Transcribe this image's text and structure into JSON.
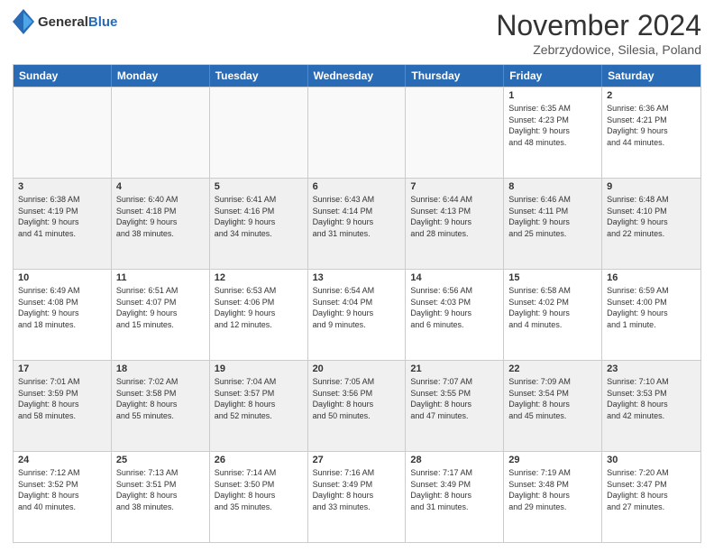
{
  "header": {
    "logo_general": "General",
    "logo_blue": "Blue",
    "month_title": "November 2024",
    "location": "Zebrzydowice, Silesia, Poland"
  },
  "weekdays": [
    "Sunday",
    "Monday",
    "Tuesday",
    "Wednesday",
    "Thursday",
    "Friday",
    "Saturday"
  ],
  "rows": [
    [
      {
        "day": "",
        "info": ""
      },
      {
        "day": "",
        "info": ""
      },
      {
        "day": "",
        "info": ""
      },
      {
        "day": "",
        "info": ""
      },
      {
        "day": "",
        "info": ""
      },
      {
        "day": "1",
        "info": "Sunrise: 6:35 AM\nSunset: 4:23 PM\nDaylight: 9 hours\nand 48 minutes."
      },
      {
        "day": "2",
        "info": "Sunrise: 6:36 AM\nSunset: 4:21 PM\nDaylight: 9 hours\nand 44 minutes."
      }
    ],
    [
      {
        "day": "3",
        "info": "Sunrise: 6:38 AM\nSunset: 4:19 PM\nDaylight: 9 hours\nand 41 minutes."
      },
      {
        "day": "4",
        "info": "Sunrise: 6:40 AM\nSunset: 4:18 PM\nDaylight: 9 hours\nand 38 minutes."
      },
      {
        "day": "5",
        "info": "Sunrise: 6:41 AM\nSunset: 4:16 PM\nDaylight: 9 hours\nand 34 minutes."
      },
      {
        "day": "6",
        "info": "Sunrise: 6:43 AM\nSunset: 4:14 PM\nDaylight: 9 hours\nand 31 minutes."
      },
      {
        "day": "7",
        "info": "Sunrise: 6:44 AM\nSunset: 4:13 PM\nDaylight: 9 hours\nand 28 minutes."
      },
      {
        "day": "8",
        "info": "Sunrise: 6:46 AM\nSunset: 4:11 PM\nDaylight: 9 hours\nand 25 minutes."
      },
      {
        "day": "9",
        "info": "Sunrise: 6:48 AM\nSunset: 4:10 PM\nDaylight: 9 hours\nand 22 minutes."
      }
    ],
    [
      {
        "day": "10",
        "info": "Sunrise: 6:49 AM\nSunset: 4:08 PM\nDaylight: 9 hours\nand 18 minutes."
      },
      {
        "day": "11",
        "info": "Sunrise: 6:51 AM\nSunset: 4:07 PM\nDaylight: 9 hours\nand 15 minutes."
      },
      {
        "day": "12",
        "info": "Sunrise: 6:53 AM\nSunset: 4:06 PM\nDaylight: 9 hours\nand 12 minutes."
      },
      {
        "day": "13",
        "info": "Sunrise: 6:54 AM\nSunset: 4:04 PM\nDaylight: 9 hours\nand 9 minutes."
      },
      {
        "day": "14",
        "info": "Sunrise: 6:56 AM\nSunset: 4:03 PM\nDaylight: 9 hours\nand 6 minutes."
      },
      {
        "day": "15",
        "info": "Sunrise: 6:58 AM\nSunset: 4:02 PM\nDaylight: 9 hours\nand 4 minutes."
      },
      {
        "day": "16",
        "info": "Sunrise: 6:59 AM\nSunset: 4:00 PM\nDaylight: 9 hours\nand 1 minute."
      }
    ],
    [
      {
        "day": "17",
        "info": "Sunrise: 7:01 AM\nSunset: 3:59 PM\nDaylight: 8 hours\nand 58 minutes."
      },
      {
        "day": "18",
        "info": "Sunrise: 7:02 AM\nSunset: 3:58 PM\nDaylight: 8 hours\nand 55 minutes."
      },
      {
        "day": "19",
        "info": "Sunrise: 7:04 AM\nSunset: 3:57 PM\nDaylight: 8 hours\nand 52 minutes."
      },
      {
        "day": "20",
        "info": "Sunrise: 7:05 AM\nSunset: 3:56 PM\nDaylight: 8 hours\nand 50 minutes."
      },
      {
        "day": "21",
        "info": "Sunrise: 7:07 AM\nSunset: 3:55 PM\nDaylight: 8 hours\nand 47 minutes."
      },
      {
        "day": "22",
        "info": "Sunrise: 7:09 AM\nSunset: 3:54 PM\nDaylight: 8 hours\nand 45 minutes."
      },
      {
        "day": "23",
        "info": "Sunrise: 7:10 AM\nSunset: 3:53 PM\nDaylight: 8 hours\nand 42 minutes."
      }
    ],
    [
      {
        "day": "24",
        "info": "Sunrise: 7:12 AM\nSunset: 3:52 PM\nDaylight: 8 hours\nand 40 minutes."
      },
      {
        "day": "25",
        "info": "Sunrise: 7:13 AM\nSunset: 3:51 PM\nDaylight: 8 hours\nand 38 minutes."
      },
      {
        "day": "26",
        "info": "Sunrise: 7:14 AM\nSunset: 3:50 PM\nDaylight: 8 hours\nand 35 minutes."
      },
      {
        "day": "27",
        "info": "Sunrise: 7:16 AM\nSunset: 3:49 PM\nDaylight: 8 hours\nand 33 minutes."
      },
      {
        "day": "28",
        "info": "Sunrise: 7:17 AM\nSunset: 3:49 PM\nDaylight: 8 hours\nand 31 minutes."
      },
      {
        "day": "29",
        "info": "Sunrise: 7:19 AM\nSunset: 3:48 PM\nDaylight: 8 hours\nand 29 minutes."
      },
      {
        "day": "30",
        "info": "Sunrise: 7:20 AM\nSunset: 3:47 PM\nDaylight: 8 hours\nand 27 minutes."
      }
    ]
  ]
}
